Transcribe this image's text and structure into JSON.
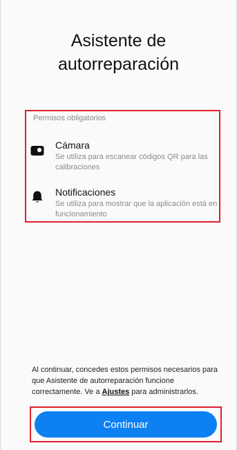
{
  "title": {
    "line1": "Asistente de",
    "line2": "autorreparación"
  },
  "permissions": {
    "header": "Permisos obligatorios",
    "items": [
      {
        "icon": "camera-icon",
        "name": "Cámara",
        "description": "Se utiliza para escanear códigos QR para las calibraciones"
      },
      {
        "icon": "bell-icon",
        "name": "Notificaciones",
        "description": "Se utiliza para mostrar que la aplicación está en funcionamiento"
      }
    ]
  },
  "footer": {
    "text_before": "Al continuar, concedes estos permisos necesarios para que Asistente de autorreparación funcione correctamente. Ve a ",
    "link": "Ajustes",
    "text_after": " para administrarlos."
  },
  "continue_button": {
    "label": "Continuar"
  },
  "colors": {
    "accent": "#0d80f2",
    "highlight_border": "#e01e2a"
  }
}
